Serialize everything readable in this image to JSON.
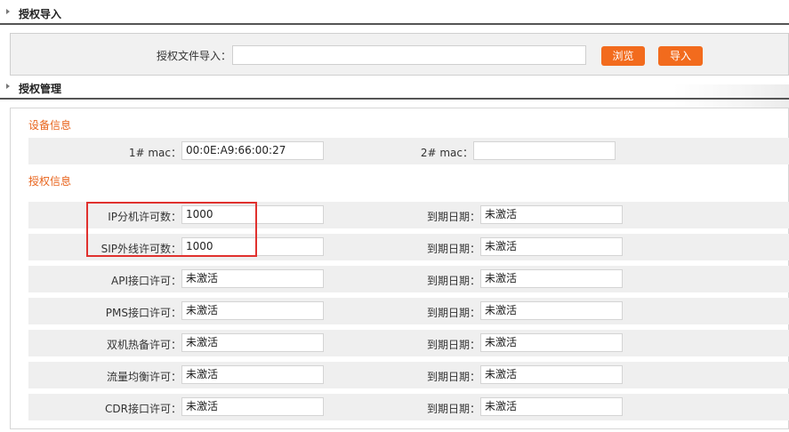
{
  "import_section": {
    "title": "授权导入",
    "file_label": "授权文件导入：",
    "file_value": "",
    "browse_button": "浏览",
    "import_button": "导入"
  },
  "management_section": {
    "title": "授权管理",
    "device_info": {
      "title": "设备信息",
      "mac1_label": "1# mac：",
      "mac1_value": "00:0E:A9:66:00:27",
      "mac2_label": "2# mac：",
      "mac2_value": ""
    },
    "license_info": {
      "title": "授权信息",
      "expire_label": "到期日期：",
      "rows": [
        {
          "label": "IP分机许可数：",
          "value": "1000",
          "expire": "未激活"
        },
        {
          "label": "SIP外线许可数：",
          "value": "1000",
          "expire": "未激活"
        },
        {
          "label": "API接口许可：",
          "value": "未激活",
          "expire": "未激活"
        },
        {
          "label": "PMS接口许可：",
          "value": "未激活",
          "expire": "未激活"
        },
        {
          "label": "双机热备许可：",
          "value": "未激活",
          "expire": "未激活"
        },
        {
          "label": "流量均衡许可：",
          "value": "未激活",
          "expire": "未激活"
        },
        {
          "label": "CDR接口许可：",
          "value": "未激活",
          "expire": "未激活"
        }
      ]
    }
  },
  "colors": {
    "accent": "#f26b1d",
    "group_title": "#e8641c",
    "highlight": "#e0312e"
  }
}
